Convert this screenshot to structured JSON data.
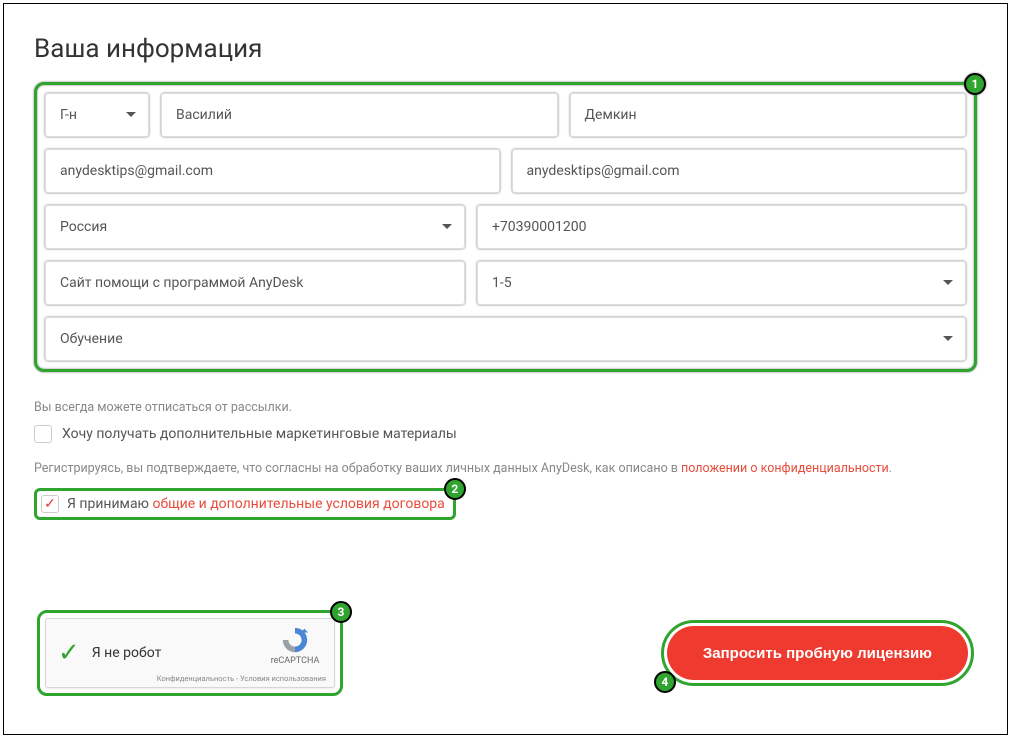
{
  "title": "Ваша информация",
  "form": {
    "salutation": "Г-н",
    "first_name": "Василий",
    "last_name": "Демкин",
    "email": "anydesktips@gmail.com",
    "email_confirm": "anydesktips@gmail.com",
    "country": "Россия",
    "phone": "+70390001200",
    "company": "Сайт помощи с программой AnyDesk",
    "employees": "1-5",
    "purpose": "Обучение"
  },
  "unsubscribe_note": "Вы всегда можете отписаться от рассылки.",
  "marketing_opt_in": "Хочу получать дополнительные маркетинговые материалы",
  "agree_prefix": "Регистрируясь, вы подтверждаете, что согласны на обработку ваших личных данных AnyDesk, как описано в ",
  "agree_link": "положении о конфиденциальности",
  "agree_suffix": ".",
  "accept_prefix": "Я принимаю ",
  "accept_link": "общие и дополнительные условия договора",
  "recaptcha": {
    "label": "Я не робот",
    "brand": "reCAPTCHA",
    "fineprint": "Конфиденциальность - Условия использования"
  },
  "submit": "Запросить пробную лицензию",
  "badges": {
    "b1": "1",
    "b2": "2",
    "b3": "3",
    "b4": "4"
  }
}
